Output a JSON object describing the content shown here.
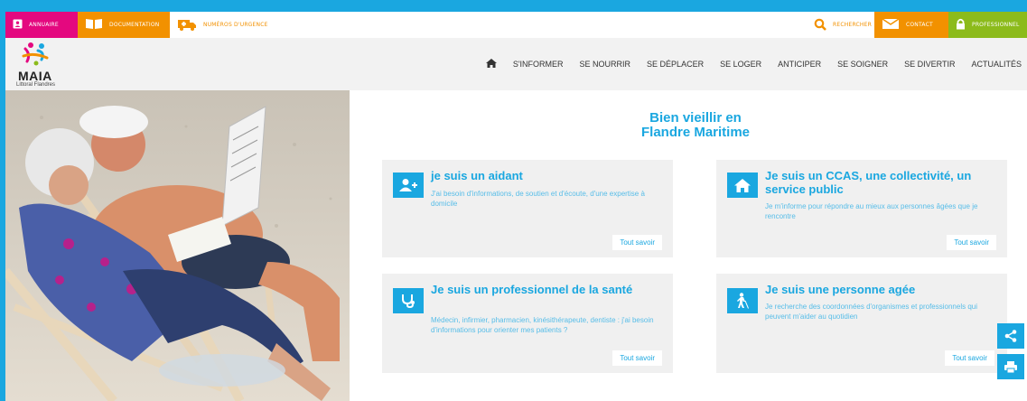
{
  "topbar": {
    "annuaire": "ANNUAIRE",
    "documentation": "DOCUMENTATION",
    "urgence": "NUMÉROS D'URGENCE",
    "search": "RECHERCHER",
    "contact": "CONTACT",
    "pro": "PROFESSIONNEL"
  },
  "logo": {
    "title": "MAIA",
    "subtitle": "Littoral Flandres"
  },
  "nav": {
    "items": [
      "S'INFORMER",
      "SE NOURRIR",
      "SE DÉPLACER",
      "SE LOGER",
      "ANTICIPER",
      "SE SOIGNER",
      "SE DIVERTIR",
      "ACTUALITÉS"
    ]
  },
  "headline": {
    "line1": "Bien vieillir en",
    "line2": "Flandre Maritime"
  },
  "cards": [
    {
      "title": "je suis un aidant",
      "desc": "J'ai besoin d'informations, de soutien et d'écoute, d'une expertise à domicile",
      "button": "Tout savoir",
      "icon": "add-user-icon"
    },
    {
      "title": "Je suis un CCAS, une collectivité, un service public",
      "desc": "Je m'informe pour répondre au mieux aux personnes âgées que je rencontre",
      "button": "Tout savoir",
      "icon": "home-icon"
    },
    {
      "title": "Je suis un professionnel de la santé",
      "desc": "Médecin, infirmier, pharmacien, kinésithérapeute, dentiste : j'ai besoin d'informations pour orienter mes patients ?",
      "button": "Tout savoir",
      "icon": "stethoscope-icon"
    },
    {
      "title": "Je suis une personne agée",
      "desc": "Je recherche des coordonnées d'organismes et professionnels qui peuvent m'aider au quotidien",
      "button": "Tout savoir",
      "icon": "blind-person-icon"
    }
  ],
  "colors": {
    "accent": "#1aa7e0",
    "pink": "#e4087f",
    "orange": "#f29100",
    "green": "#8cbb1b"
  }
}
